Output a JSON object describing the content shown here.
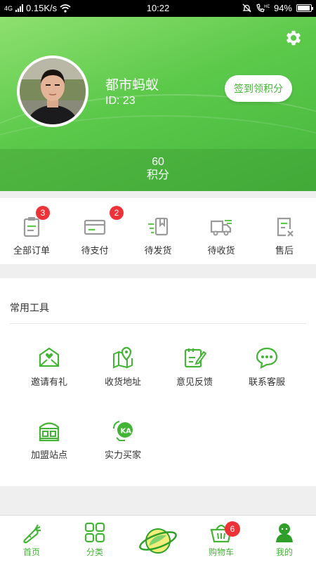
{
  "status_bar": {
    "signal_text": "4G",
    "speed": "0.15K/s",
    "time": "10:22",
    "battery": "94%",
    "battery_level": 0.94
  },
  "profile": {
    "name": "都市蚂蚁",
    "id_text": "ID: 23",
    "sign_button": "签到领积分",
    "points_value": "60",
    "points_label": "积分"
  },
  "orders": [
    {
      "label": "全部订单",
      "badge": "3",
      "icon": "clipboard-icon"
    },
    {
      "label": "待支付",
      "badge": "2",
      "icon": "card-icon"
    },
    {
      "label": "待发货",
      "badge": "",
      "icon": "book-shipping-icon"
    },
    {
      "label": "待收货",
      "badge": "",
      "icon": "truck-icon"
    },
    {
      "label": "售后",
      "badge": "",
      "icon": "return-icon"
    }
  ],
  "tools": {
    "title": "常用工具",
    "items": [
      {
        "label": "邀请有礼",
        "icon": "gift-envelope-icon"
      },
      {
        "label": "收货地址",
        "icon": "map-pin-icon"
      },
      {
        "label": "意见反馈",
        "icon": "feedback-icon"
      },
      {
        "label": "联系客服",
        "icon": "chat-icon"
      },
      {
        "label": "加盟站点",
        "icon": "store-icon"
      },
      {
        "label": "实力买家",
        "icon": "ka-badge-icon"
      }
    ]
  },
  "tabbar": {
    "items": [
      {
        "label": "首页",
        "icon": "carrot-icon"
      },
      {
        "label": "分类",
        "icon": "grid-icon"
      },
      {
        "label": "",
        "icon": "planet-icon"
      },
      {
        "label": "购物车",
        "icon": "basket-icon",
        "badge": "6"
      },
      {
        "label": "我的",
        "icon": "user-icon"
      }
    ]
  },
  "colors": {
    "accent": "#43b436",
    "badge": "#ee3338",
    "header_light": "#8ee06f",
    "header_dark": "#45b63c"
  }
}
